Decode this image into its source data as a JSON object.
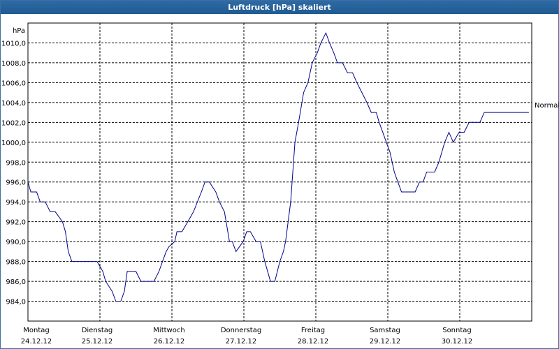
{
  "window": {
    "title": "Luftdruck [hPa] skaliert"
  },
  "colors": {
    "title_bg": "#2a659e",
    "line": "#00008b",
    "grid": "#000000"
  },
  "chart_data": {
    "type": "line",
    "title": "Luftdruck [hPa] skaliert",
    "ylabel": "hPa",
    "ylim": [
      982.0,
      1012.0
    ],
    "yticks": [
      984.0,
      986.0,
      988.0,
      990.0,
      992.0,
      994.0,
      996.0,
      998.0,
      1000.0,
      1002.0,
      1004.0,
      1006.0,
      1008.0,
      1010.0
    ],
    "ytick_labels": [
      "984,0",
      "986,0",
      "988,0",
      "990,0",
      "992,0",
      "994,0",
      "996,0",
      "998,0",
      "1000,0",
      "1002,0",
      "1004,0",
      "1006,0",
      "1008,0",
      "1010,0"
    ],
    "xlim": [
      0,
      7
    ],
    "xticks": [
      0,
      1,
      2,
      3,
      4,
      5,
      6
    ],
    "xtick_labels": [
      {
        "day": "Montag",
        "date": "24.12.12"
      },
      {
        "day": "Dienstag",
        "date": "25.12.12"
      },
      {
        "day": "Mittwoch",
        "date": "26.12.12"
      },
      {
        "day": "Donnerstag",
        "date": "27.12.12"
      },
      {
        "day": "Freitag",
        "date": "28.12.12"
      },
      {
        "day": "Samstag",
        "date": "29.12.12"
      },
      {
        "day": "Sonntag",
        "date": "30.12.12"
      }
    ],
    "grid": true,
    "reference_line": {
      "label": "Normal",
      "y": 1003.5
    },
    "series": [
      {
        "x": [
          0.0,
          0.04,
          0.12,
          0.17,
          0.24,
          0.31,
          0.38,
          0.48,
          0.52,
          0.56,
          0.61,
          0.66,
          0.69,
          0.96,
          1.04,
          1.08,
          1.17,
          1.22,
          1.29,
          1.34,
          1.38,
          1.45,
          1.5,
          1.57,
          1.64,
          1.67,
          1.75,
          1.82,
          1.87,
          1.92,
          1.96,
          2.04,
          2.07,
          2.14,
          2.22,
          2.3,
          2.41,
          2.46,
          2.52,
          2.61,
          2.66,
          2.73,
          2.8,
          2.84,
          2.89,
          2.99,
          3.04,
          3.09,
          3.17,
          3.23,
          3.29,
          3.37,
          3.43,
          3.5,
          3.55,
          3.58,
          3.65,
          3.71,
          3.76,
          3.83,
          3.89,
          3.95,
          4.02,
          4.07,
          4.14,
          4.19,
          4.25,
          4.3,
          4.37,
          4.44,
          4.51,
          4.57,
          4.64,
          4.71,
          4.77,
          4.84,
          4.88,
          4.93,
          4.98,
          5.03,
          5.09,
          5.14,
          5.19,
          5.26,
          5.32,
          5.38,
          5.44,
          5.49,
          5.54,
          5.59,
          5.65,
          5.71,
          5.75,
          5.79,
          5.85,
          5.91,
          5.99,
          6.06,
          6.13,
          6.2,
          6.28,
          6.34,
          6.41,
          6.47,
          6.53,
          6.59,
          6.64,
          6.7,
          6.77,
          6.82,
          6.89,
          6.96
        ],
        "values": [
          996.0,
          995.0,
          995.0,
          994.0,
          994.0,
          993.0,
          993.0,
          992.0,
          991.0,
          989.0,
          988.0,
          988.0,
          988.0,
          988.0,
          987.0,
          986.0,
          985.0,
          984.0,
          984.0,
          985.0,
          987.0,
          987.0,
          987.0,
          986.0,
          986.0,
          986.0,
          986.0,
          987.0,
          988.0,
          989.0,
          989.5,
          990.0,
          991.0,
          991.0,
          992.0,
          993.0,
          995.0,
          996.0,
          996.0,
          995.0,
          994.0,
          993.0,
          990.0,
          990.0,
          989.0,
          990.0,
          991.0,
          991.0,
          990.0,
          990.0,
          988.0,
          986.0,
          986.0,
          988.0,
          989.0,
          990.0,
          994.0,
          1000.0,
          1002.0,
          1005.0,
          1006.0,
          1008.0,
          1009.0,
          1010.0,
          1011.0,
          1010.0,
          1009.0,
          1008.0,
          1008.0,
          1007.0,
          1007.0,
          1006.0,
          1005.0,
          1004.0,
          1003.0,
          1003.0,
          1002.0,
          1001.0,
          1000.0,
          999.0,
          997.0,
          996.0,
          995.0,
          995.0,
          995.0,
          995.0,
          996.0,
          996.0,
          997.0,
          997.0,
          997.0,
          998.0,
          999.0,
          1000.0,
          1001.0,
          1000.0,
          1001.0,
          1001.0,
          1002.0,
          1002.0,
          1002.0,
          1003.0,
          1003.0,
          1003.0,
          1003.0,
          1003.0,
          1003.0,
          1003.0,
          1003.0,
          1003.0,
          1003.0,
          1003.0
        ]
      }
    ]
  }
}
